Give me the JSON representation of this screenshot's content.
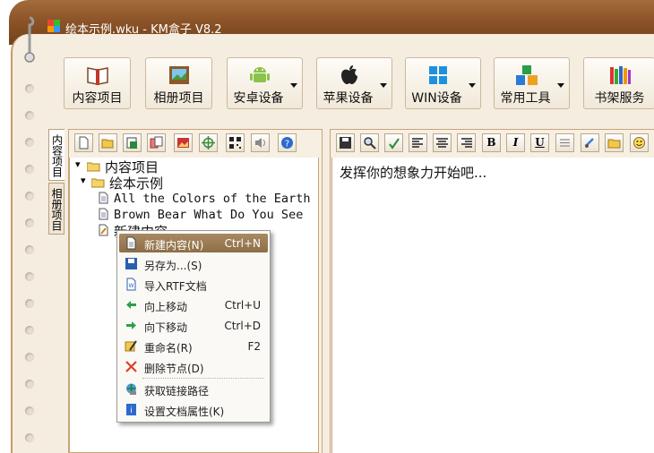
{
  "window": {
    "title": "绘本示例.wku - KM盒子 V8.2"
  },
  "toolbar": {
    "buttons": [
      {
        "label": "内容项目",
        "icon": "book-icon",
        "dropdown": false
      },
      {
        "label": "相册项目",
        "icon": "photo-album-icon",
        "dropdown": false
      },
      {
        "label": "安卓设备",
        "icon": "android-icon",
        "dropdown": true
      },
      {
        "label": "苹果设备",
        "icon": "apple-icon",
        "dropdown": true
      },
      {
        "label": "WIN设备",
        "icon": "windows-icon",
        "dropdown": true
      },
      {
        "label": "常用工具",
        "icon": "tools-icon",
        "dropdown": true
      },
      {
        "label": "书架服务",
        "icon": "bookshelf-icon",
        "dropdown": false
      }
    ]
  },
  "side_tabs": {
    "content": "内容项目",
    "album": "相册项目"
  },
  "left_toolbar_icons": [
    "new-doc-icon",
    "open-folder-icon",
    "save-as-icon",
    "import-icon",
    "image-icon",
    "target-icon",
    "qrcode-icon",
    "speaker-icon",
    "help-icon"
  ],
  "right_toolbar": {
    "icons": [
      "save-icon",
      "find-icon",
      "spellcheck-icon",
      "align-left-icon",
      "align-center-icon",
      "align-right-icon",
      "bold-icon",
      "italic-icon",
      "underline-icon",
      "strikethrough-icon",
      "clear-format-icon",
      "insert-image-icon",
      "emoji-icon"
    ],
    "bold": "B",
    "italic": "I",
    "underline": "U"
  },
  "tree": {
    "root": "内容项目",
    "folder": "绘本示例",
    "items": [
      "All the Colors of the Earth",
      "Brown Bear What Do You See",
      "新建内容"
    ]
  },
  "editor": {
    "placeholder": "发挥你的想象力开始吧..."
  },
  "context_menu": [
    {
      "label": "新建内容(N)",
      "shortcut": "Ctrl+N",
      "icon": "new-content-icon"
    },
    {
      "label": "另存为...(S)",
      "shortcut": "",
      "icon": "save-as-icon"
    },
    {
      "label": "导入RTF文档",
      "shortcut": "",
      "icon": "import-rtf-icon"
    },
    {
      "label": "向上移动",
      "shortcut": "Ctrl+U",
      "icon": "arrow-left-icon"
    },
    {
      "label": "向下移动",
      "shortcut": "Ctrl+D",
      "icon": "arrow-right-icon"
    },
    {
      "label": "重命名(R)",
      "shortcut": "F2",
      "icon": "rename-icon"
    },
    {
      "label": "删除节点(D)",
      "shortcut": "",
      "icon": "delete-icon"
    },
    {
      "label": "获取链接路径",
      "shortcut": "",
      "icon": "link-path-icon"
    },
    {
      "label": "设置文档属性(K)",
      "shortcut": "",
      "icon": "properties-icon"
    }
  ],
  "colors": {
    "frame": "#8c5428",
    "paper": "#f5ede0",
    "menu_highlight": "#9a7a52"
  }
}
